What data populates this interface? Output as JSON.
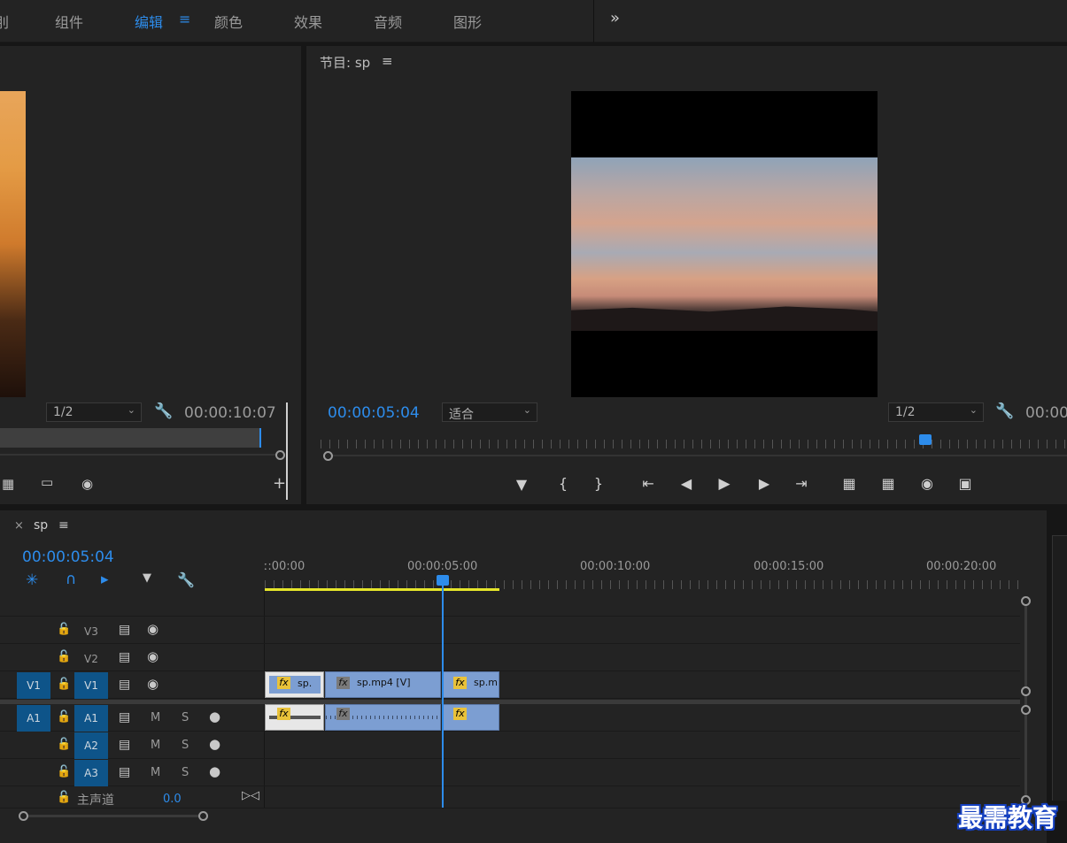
{
  "workspaces": {
    "partial": "刖",
    "items": [
      "组件",
      "编辑",
      "颜色",
      "效果",
      "音频",
      "图形"
    ],
    "active_index": 1,
    "active_menu_icon": "≡",
    "more": "»"
  },
  "source": {
    "zoom": "1/2",
    "timecode": "00:00:10:07"
  },
  "program": {
    "title": "节目: sp",
    "menu": "≡",
    "timecode": "00:00:05:04",
    "fit": "适合",
    "zoom": "1/2",
    "end_timecode": "00:00"
  },
  "timeline": {
    "tab_close": "×",
    "tab_name": "sp",
    "tab_menu": "≡",
    "timecode": "00:00:05:04",
    "ruler": [
      "ː:00:00",
      "00:00:05:00",
      "00:00:10:00",
      "00:00:15:00",
      "00:00:20:00"
    ],
    "video_tracks": [
      {
        "name": "V3",
        "target": ""
      },
      {
        "name": "V2",
        "target": ""
      },
      {
        "name": "V1",
        "target": "V1"
      }
    ],
    "audio_tracks": [
      {
        "name": "A1",
        "target": "A1",
        "m": "M",
        "s": "S"
      },
      {
        "name": "A2",
        "target": "",
        "m": "M",
        "s": "S"
      },
      {
        "name": "A3",
        "target": "",
        "m": "M",
        "s": "S"
      }
    ],
    "master": {
      "label": "主声道",
      "value": "0.0"
    },
    "clips": {
      "v1_a": "sp.",
      "v1_b": "sp.mp4 [V]",
      "v1_c": "sp.m",
      "fx": "fx"
    },
    "playhead_time": "00:00:05:04"
  },
  "watermark": "最需教育",
  "colors": {
    "accent": "#2d8ceb",
    "clip": "#7c9ed2",
    "target": "#0e5489",
    "work_area": "#e5e52a"
  }
}
